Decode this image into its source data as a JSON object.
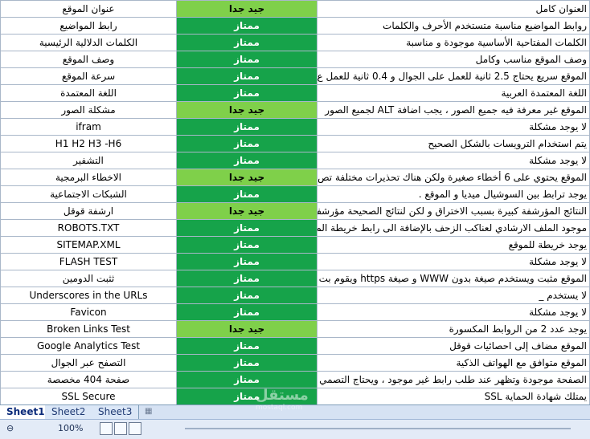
{
  "rows": [
    {
      "label": "عنوان الموقع",
      "grade": "جيد جدا",
      "gradeType": "verygood",
      "note": "العنوان كامل"
    },
    {
      "label": "رابط المواضيع",
      "grade": "ممتاز",
      "gradeType": "excellent",
      "note": "روابط المواضيع مناسبة متستخدم الأحرف والكلمات"
    },
    {
      "label": "الكلمات الدلالية الرئيسية",
      "grade": "ممتاز",
      "gradeType": "excellent",
      "note": "الكلمات المفتاحية الأساسية موجودة و مناسبة"
    },
    {
      "label": "وصف الموقع",
      "grade": "ممتاز",
      "gradeType": "excellent",
      "note": "وصف الموقع مناسب وكامل"
    },
    {
      "label": "سرعة الموقع",
      "grade": "ممتاز",
      "gradeType": "excellent",
      "note": "الموقع سريع يحتاج 2.5 ثانية للعمل على الجوال و 0.4 ثانية للعمل ع"
    },
    {
      "label": "اللغة المعتمدة",
      "grade": "ممتاز",
      "gradeType": "excellent",
      "note": "اللغة المعتمدة العربية"
    },
    {
      "label": "مشكلة الصور",
      "grade": "جيد جدا",
      "gradeType": "verygood",
      "note": "الموقع غير معرفة فيه جميع الصور ، يجب اضافة ALT لجميع الصور"
    },
    {
      "label": "ifram",
      "grade": "ممتاز",
      "gradeType": "excellent",
      "note": "لا يوجد مشكلة"
    },
    {
      "label": "H1 H2 H3 -H6",
      "grade": "ممتاز",
      "gradeType": "excellent",
      "note": "يتم استخدام الترويسات بالشكل الصحيح"
    },
    {
      "label": "التشفير",
      "grade": "ممتاز",
      "gradeType": "excellent",
      "note": "لا يوجد مشكلة"
    },
    {
      "label": "الاخطاء البرمجية",
      "grade": "جيد جدا",
      "gradeType": "verygood",
      "note": "الموقع يحتوي على 6 أخطاء صغيرة ولكن هناك تحذيرات مختلفة تص"
    },
    {
      "label": "الشبكات الاجتماعية",
      "grade": "ممتاز",
      "gradeType": "excellent",
      "note": "يوجد ترابط بين السوشيال ميديا و الموقع ."
    },
    {
      "label": "ارشفة قوقل",
      "grade": "جيد جدا",
      "gradeType": "verygood",
      "note": "النتائج المؤرشفة كبيرة بسبب الاختراق و لكن لنتائج الصحيحة مؤرشفة"
    },
    {
      "label": "ROBOTS.TXT",
      "grade": "ممتاز",
      "gradeType": "excellent",
      "note": "موجود الملف الارشادي لعناكب الزحف بالإضافة الى رابط خريطة المو"
    },
    {
      "label": "SITEMAP.XML",
      "grade": "ممتاز",
      "gradeType": "excellent",
      "note": "يوجد خريطة للموقع"
    },
    {
      "label": "FLASH TEST",
      "grade": "ممتاز",
      "gradeType": "excellent",
      "note": "لا يوجد مشكلة"
    },
    {
      "label": "ثثبت الدومين",
      "grade": "ممتاز",
      "gradeType": "excellent",
      "note": "الموقع مثبت ويستخدم صيغة بدون WWW و صيغة https ويقوم بت"
    },
    {
      "label": "Underscores in the URLs",
      "grade": "ممتاز",
      "gradeType": "excellent",
      "note": "لا يستخدم _"
    },
    {
      "label": "Favicon",
      "grade": "ممتاز",
      "gradeType": "excellent",
      "note": "لا يوجد مشكلة"
    },
    {
      "label": "Broken Links Test",
      "grade": "جيد جدا",
      "gradeType": "verygood",
      "note": "يوجد عدد 2 من الروابط المكسورة"
    },
    {
      "label": "Google Analytics Test",
      "grade": "ممتاز",
      "gradeType": "excellent",
      "note": "الموقع مضاف إلى احصائيات قوقل"
    },
    {
      "label": "التصفح عبر الجوال",
      "grade": "ممتاز",
      "gradeType": "excellent",
      "note": "الموقع متوافق مع الهواتف الذكية"
    },
    {
      "label": "صفحة 404 مخصصة",
      "grade": "ممتاز",
      "gradeType": "excellent",
      "note": "الصفحة موجودة وتظهر عند طلب رابط غير موجود ، ويحتاج التصمي"
    },
    {
      "label": "SSL Secure",
      "grade": "ممتاز",
      "gradeType": "excellent",
      "note": "يمتلك شهادة الحماية SSL"
    }
  ],
  "tabs": [
    "Sheet1",
    "Sheet2",
    "Sheet3"
  ],
  "statusbar": {
    "zoom": "100%"
  },
  "watermark": "مستقل\nmostaql.com",
  "icons": {
    "newsheet": "insert-sheet-icon",
    "zoomout": "minus-icon",
    "normal": "normal-view-icon",
    "layout": "page-layout-icon",
    "break": "page-break-icon"
  },
  "colors": {
    "excellent": "#16a34a",
    "verygood": "#7fd04a",
    "grid": "#a9b7c9",
    "tabbar": "#d6e2f3"
  }
}
